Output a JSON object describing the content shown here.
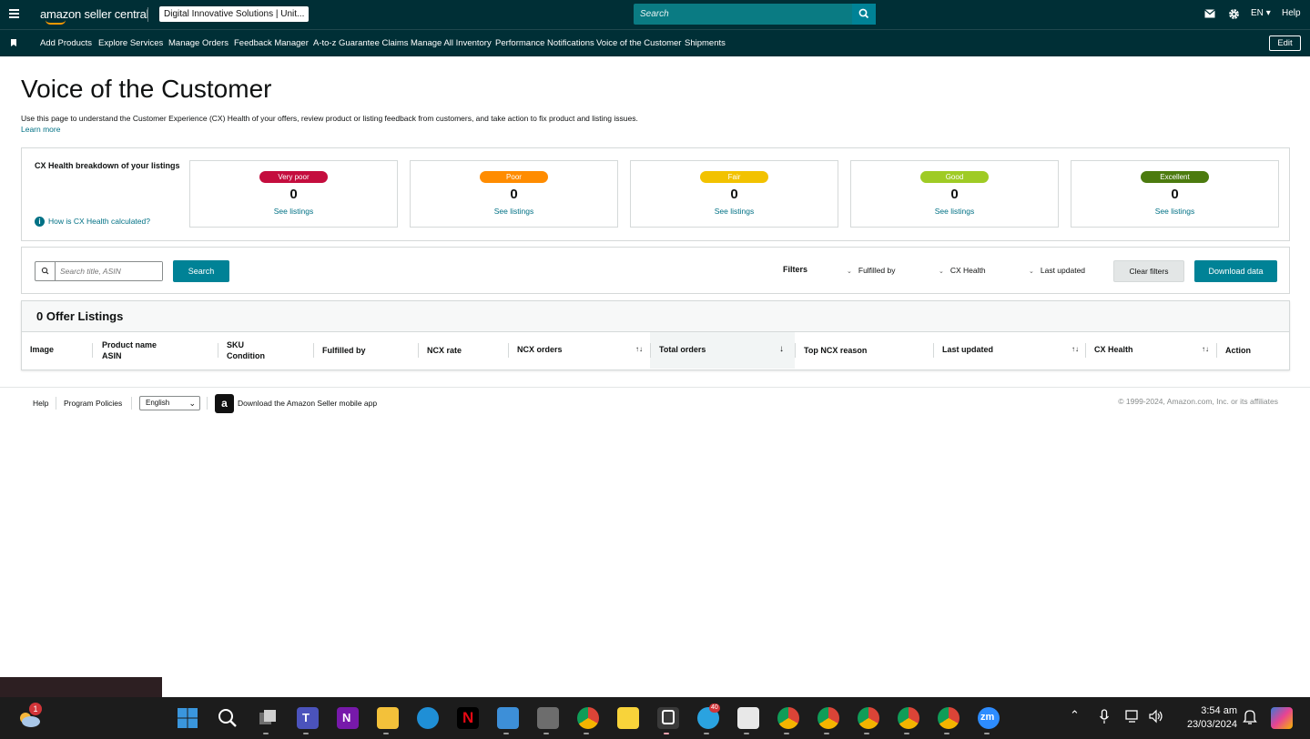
{
  "header": {
    "logo_text": "amazon seller central",
    "account": "Digital Innovative Solutions | Unit...",
    "search_placeholder": "Search",
    "language": "EN",
    "language_arrow": "▾",
    "help": "Help"
  },
  "nav": {
    "items": [
      "Add Products",
      "Explore Services",
      "Manage Orders",
      "Feedback Manager",
      "A-to-z Guarantee Claims",
      "Manage All Inventory",
      "Performance Notifications",
      "Voice of the Customer",
      "Shipments"
    ],
    "edit": "Edit"
  },
  "page": {
    "title": "Voice of the Customer",
    "description": "Use this page to understand the Customer Experience (CX) Health of your offers, review product or listing feedback from customers, and take action to fix product and listing issues.",
    "learn_more": "Learn more"
  },
  "cx_health": {
    "title": "CX Health breakdown of your listings",
    "help_link": "How is CX Health calculated?",
    "cards": [
      {
        "label": "Very poor",
        "count": "0",
        "link": "See listings",
        "color": "#c40d3e"
      },
      {
        "label": "Poor",
        "count": "0",
        "link": "See listings",
        "color": "#ff8c00"
      },
      {
        "label": "Fair",
        "count": "0",
        "link": "See listings",
        "color": "#f2c200"
      },
      {
        "label": "Good",
        "count": "0",
        "link": "See listings",
        "color": "#9fcb25"
      },
      {
        "label": "Excellent",
        "count": "0",
        "link": "See listings",
        "color": "#4c7b0f"
      }
    ]
  },
  "filters": {
    "search_placeholder": "Search title, ASIN",
    "search_button": "Search",
    "label": "Filters",
    "fulfilled_by": "Fulfilled by",
    "cx_health": "CX Health",
    "last_updated": "Last updated",
    "clear": "Clear filters",
    "download": "Download data"
  },
  "table": {
    "heading": "0 Offer Listings",
    "columns": [
      {
        "line1": "Image",
        "line2": ""
      },
      {
        "line1": "Product name",
        "line2": "ASIN"
      },
      {
        "line1": "SKU",
        "line2": "Condition"
      },
      {
        "line1": "Fulfilled by",
        "line2": ""
      },
      {
        "line1": "NCX rate",
        "line2": ""
      },
      {
        "line1": "NCX orders",
        "line2": ""
      },
      {
        "line1": "Total orders",
        "line2": ""
      },
      {
        "line1": "Top NCX reason",
        "line2": ""
      },
      {
        "line1": "Last updated",
        "line2": ""
      },
      {
        "line1": "CX Health",
        "line2": ""
      },
      {
        "line1": "Action",
        "line2": ""
      }
    ]
  },
  "footer": {
    "help": "Help",
    "policies": "Program Policies",
    "language": "English",
    "app": "Download the Amazon Seller mobile app",
    "copyright": "© 1999-2024, Amazon.com, Inc. or its affiliates"
  },
  "taskbar": {
    "weather_badge": "1",
    "telegram_badge": "40",
    "time": "3:54 am",
    "date": "23/03/2024"
  }
}
